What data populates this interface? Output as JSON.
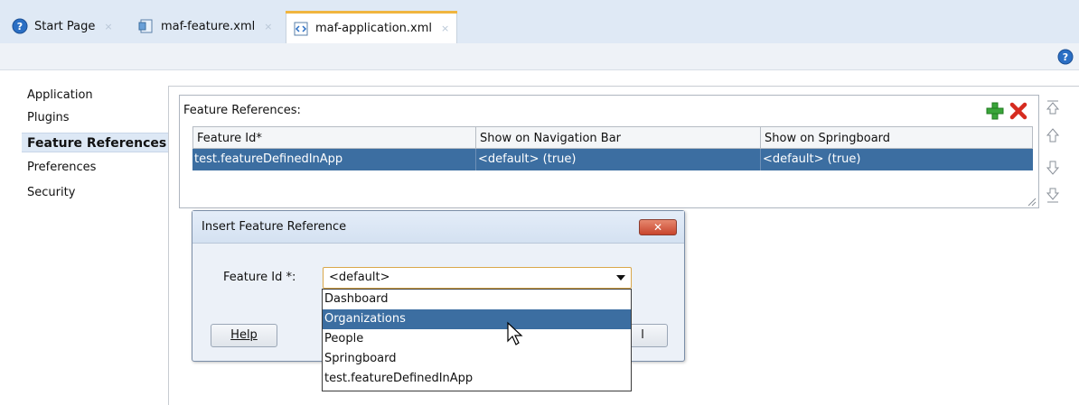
{
  "tabs": [
    {
      "label": "Start Page",
      "icon": "help-circle-icon",
      "active": false
    },
    {
      "label": "maf-feature.xml",
      "icon": "xml-file-icon",
      "active": false
    },
    {
      "label": "maf-application.xml",
      "icon": "xml-code-icon",
      "active": true
    }
  ],
  "tab_close_glyph": "×",
  "nav": {
    "items": [
      "Application",
      "Plugins",
      "Feature References",
      "Preferences",
      "Security"
    ],
    "selected": "Feature References"
  },
  "feature_refs": {
    "label": "Feature References:",
    "columns": [
      "Feature Id*",
      "Show on Navigation Bar",
      "Show on Springboard"
    ],
    "rows": [
      [
        "test.featureDefinedInApp",
        "<default> (true)",
        "<default> (true)"
      ]
    ]
  },
  "dialog": {
    "title": "Insert Feature Reference",
    "close_label": "✕",
    "field_label": "Feature Id *:",
    "selected_value": "<default>",
    "options": [
      "Dashboard",
      "Organizations",
      "People",
      "Springboard",
      "test.featureDefinedInApp"
    ],
    "highlighted_option": "Organizations",
    "help_button": "Help",
    "right_button_partial": "l"
  },
  "colors": {
    "selection": "#3c6ea1",
    "tab_accent": "#f0b53f",
    "add_green": "#3aa53a",
    "delete_red": "#d62b1f"
  }
}
